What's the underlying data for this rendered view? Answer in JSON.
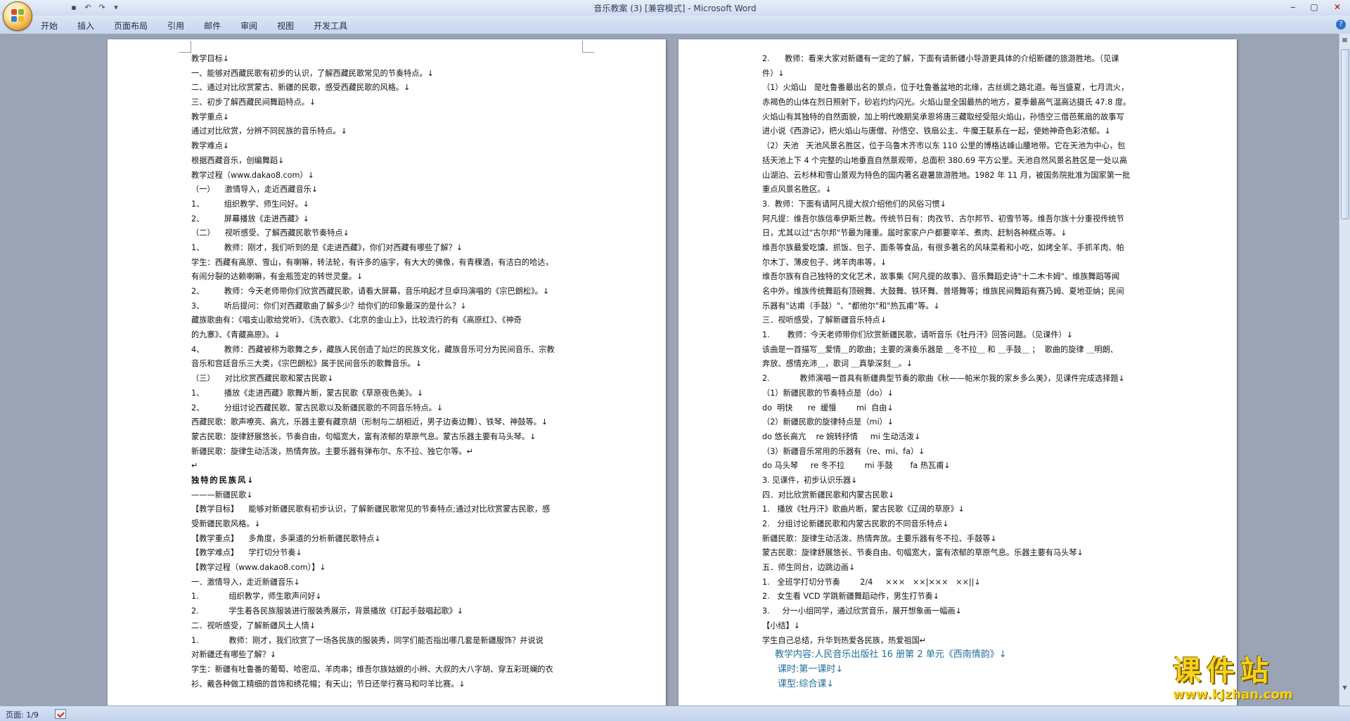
{
  "window": {
    "title": "音乐教案 (3) [兼容模式] - Microsoft Word",
    "controls": [
      "‒",
      "▢",
      "✕"
    ]
  },
  "quick_access": [
    "save-icon",
    "undo-icon",
    "redo-icon",
    "customize-icon"
  ],
  "ribbon": {
    "tabs": [
      "开始",
      "插入",
      "页面布局",
      "引用",
      "邮件",
      "审阅",
      "视图",
      "开发工具"
    ],
    "help": "?"
  },
  "document": {
    "left_page": [
      "教学目标↓",
      "一、能够对西藏民歌有初步的认识，了解西藏民歌常见的节奏特点。↓",
      "二、通过对比欣赏蒙古、新疆的民歌，感受西藏民歌的风格。↓",
      "三、初步了解西藏民间舞蹈特点。↓",
      "教学重点↓",
      "通过对比欣赏，分辨不同民族的音乐特点。↓",
      "教学难点↓",
      "根据西藏音乐，创编舞蹈↓",
      "教学过程（www.dakao8.com）↓",
      "（一）    激情导入，走近西藏音乐↓",
      "1、        组织教学、师生问好。↓",
      "2、        屏幕播放《走进西藏》↓",
      "（二）    视听感受、了解西藏民歌节奏特点↓",
      "1、        教师：刚才，我们听到的是《走进西藏》，你们对西藏有哪些了解？↓",
      "学生：西藏有高原、雪山，有喇嘛，转法轮，有许多的庙宇，有大大的佛像，有青稞酒，有洁白的哈达，",
      "有闹分裂的达赖喇嘛，有金瓶签定的转世灵童。↓",
      "2、        教师：今天老师带你们欣赏西藏民歌，请看大屏幕，音乐响起才旦卓玛演唱的《宗巴朗松》。↓",
      "3、        听后提问：你们对西藏歌曲了解多少？给你们的印象最深的是什么？↓",
      "藏族歌曲有：《唱支山歌给党听》、《洗衣歌》、《北京的金山上》，比较流行的有《高原红》、《神奇",
      "的九寨》、《青藏高原》。↓",
      "4、        教师：西藏被称为歌舞之乡，藏族人民创造了灿烂的民族文化，藏族音乐可分为民间音乐、宗教",
      "音乐和宫廷音乐三大类，《宗巴朗松》属于民间音乐的歌舞音乐。↓",
      "（三）    对比欣赏西藏民歌和蒙古民歌↓",
      "1、        播放《走进西藏》歌舞片断，蒙古民歌《草原夜色美》。↓",
      "2、        分组讨论西藏民歌、蒙古民歌以及新疆民歌的不同音乐特点。↓",
      "西藏民歌：歌声嘹亮、高亢，乐器主要有藏京胡（形制与二胡相近，男子边奏边舞）、铁琴、神鼓等。↓",
      "蒙古民歌：旋律舒展悠长，节奏自由，句幅宽大，富有浓郁的草原气息。蒙古乐器主要有马头琴。↓",
      "新疆民歌：旋律生动活泼，热情奔放。主要乐器有弹布尔、东不拉、独它尔等。↵",
      "↵",
      "独特的民族风↓",
      "———新疆民歌↓",
      "【教学目标】    能够对新疆民歌有初步认识，了解新疆民歌常见的节奏特点;通过对比欣赏蒙古民歌，感",
      "受新疆民歌风格。↓",
      "【教学重点】    多角度，多渠道的分析新疆民歌特点↓",
      "【教学难点】    学打切分节奏↓",
      "【教学过程（www.dakao8.com）】↓",
      "一．激情导入，走近新疆音乐↓",
      "1.            组织教学，师生歌声问好↓",
      "2.            学生着各民族服装进行服装秀展示，背景播放《打起手鼓唱起歌》↓",
      "二．视听感受，了解新疆风土人情↓",
      "1.            教师：刚才，我们欣赏了一场各民族的服装秀，同学们能否指出哪几套是新疆服饰？并说说",
      "对新疆还有哪些了解？↓",
      "学生：新疆有吐鲁番的葡萄、哈密瓜、羊肉串；维吾尔族姑娘的小辫、大叔的大八字胡、穿五彩斑斓的衣",
      "衫、戴各种做工精细的首饰和绣花帽；有天山；节日还举行赛马和叼羊比赛。↓"
    ],
    "right_page": [
      "2.      教师：看来大家对新疆有一定的了解，下面有请新疆小导游更具体的介绍新疆的旅游胜地。（见课",
      "件）↓",
      "（1）火焰山   是吐鲁番最出名的景点，位于吐鲁番盆地的北缘，古丝绸之路北道。每当盛夏，七月流火，",
      "赤褐色的山体在烈日照射下，砂岩灼灼闪光。火焰山是全国最热的地方，夏季最高气温高达摄氏 47.8 度。",
      "火焰山有其独特的自然面貌，加上明代晚期吴承恩将唐三藏取经受阻火焰山，孙悟空三借芭蕉扇的故事写",
      "进小说《西游记》，把火焰山与唐僧、孙悟空、铁扇公主、牛魔王联系在一起，使她神奇色彩浓郁。↓",
      "（2）天池   天池风景名胜区，位于乌鲁木齐市以东 110 公里的博格达峰山腰地带。它在天池为中心，包",
      "括天池上下 4 个完整的山地垂直自然景观带，总面积 380.69 平方公里。天池自然风景名胜区是一处以高",
      "山湖泊、云杉林和雪山景观为特色的国内著名避暑旅游胜地。1982 年 11 月，被国务院批准为国家第一批",
      "重点风景名胜区。↓",
      "3.  教师：下面有请阿凡提大叔介绍他们的风俗习惯↓",
      "阿凡提：维吾尔族信奉伊斯兰教。传统节日有：肉孜节、古尔邦节、初雪节等。维吾尔族十分重视传统节",
      "日，尤其以过\"古尔邦\"节最为隆重。届时家家户户都要宰羊、煮肉、赶制各种糕点等。↓",
      "维吾尔族最爱吃馕、抓饭、包子、面条等食品，有很多著名的风味菜肴和小吃，如烤全羊、手抓羊肉、帕",
      "尔木丁、薄皮包子、烤羊肉串等，↓",
      "维吾尔族有自己独特的文化艺术，故事集《阿凡提的故事》、音乐舞蹈史诗\"十二木卡姆\"、维族舞蹈等闻",
      "名中外。维族传统舞蹈有顶碗舞、大鼓舞、铁环舞、普塔舞等；维族民间舞蹈有赛乃姆、夏地亚纳；民间",
      "乐器有\"达甫（手鼓）\"、\"都他尔\"和\"热瓦甫\"等。↓",
      "三．视听感受，了解新疆音乐特点↓",
      "1.       教师：今天老师带你们欣赏新疆民歌，请听音乐《牡丹汗》回答问题。（见课件）↓",
      "该曲是一首描写＿爱情＿的歌曲；主要的演奏乐器是 ＿冬不拉＿ 和 ＿手鼓＿ ；  歌曲的旋律 ＿明朗、",
      "奔放、感情充沛＿，歌词 ＿真挚深刻＿。↓",
      "2.            教师演唱一首具有新疆典型节奏的歌曲《秋——帕米尔我的家乡多么美》，见课件完成选择题↓",
      "（1）新疆民歌的节奏特点是（do）↓",
      "do  明快      re  缓慢        mi  自由↓",
      "（2）新疆民歌的旋律特点是（mi）↓",
      "do 悠长高亢    re 婉转抒情     mi 生动活泼↓",
      "（3）新疆音乐常用的乐器有（re、mi、fa）↓",
      "do 马头琴     re 冬不拉        mi 手鼓       fa 热瓦甫↓",
      "3. 见课件，初步认识乐器↓",
      "四．对比欣赏新疆民歌和内蒙古民歌↓",
      "1.   播放《牡丹汗》歌曲片断，蒙古民歌《辽阔的草原》↓",
      "2.   分组讨论新疆民歌和内蒙古民歌的不同音乐特点↓",
      "新疆民歌：旋律生动活泼、热情奔放。主要乐器有冬不拉、手鼓等↓",
      "蒙古民歌：旋律舒展悠长、节奏自由、句幅宽大，富有浓郁的草原气息。乐器主要有马头琴↓",
      "五．师生同台，边跳边画↓",
      "1.   全班学打切分节奏        2/4     ×××   ××|×××   ××||↓",
      "2.   女生看 VCD 学跳新疆舞蹈动作，男生打节奏↓",
      "3.     分一小组同学，通过欣赏音乐，展开想象画一幅画↓",
      "【小结】↓",
      "学生自己总结，升华到热爱各民族，热爱祖国↵",
      "教学内容:人民音乐出版社 16 册第 2 单元《西南情韵》↓",
      "课时:第一课时↓",
      "课型:综合课↓"
    ]
  },
  "statusbar": {
    "page": "页面: 1/9"
  },
  "watermark": {
    "title": "课件站",
    "url": "www.kjzhan.com"
  },
  "colors": {
    "ribbon": "#c5d6ee",
    "workspace": "#9aa4b4",
    "watermark": "#f7d21a",
    "lesson_blue": "#1f6f9a"
  }
}
